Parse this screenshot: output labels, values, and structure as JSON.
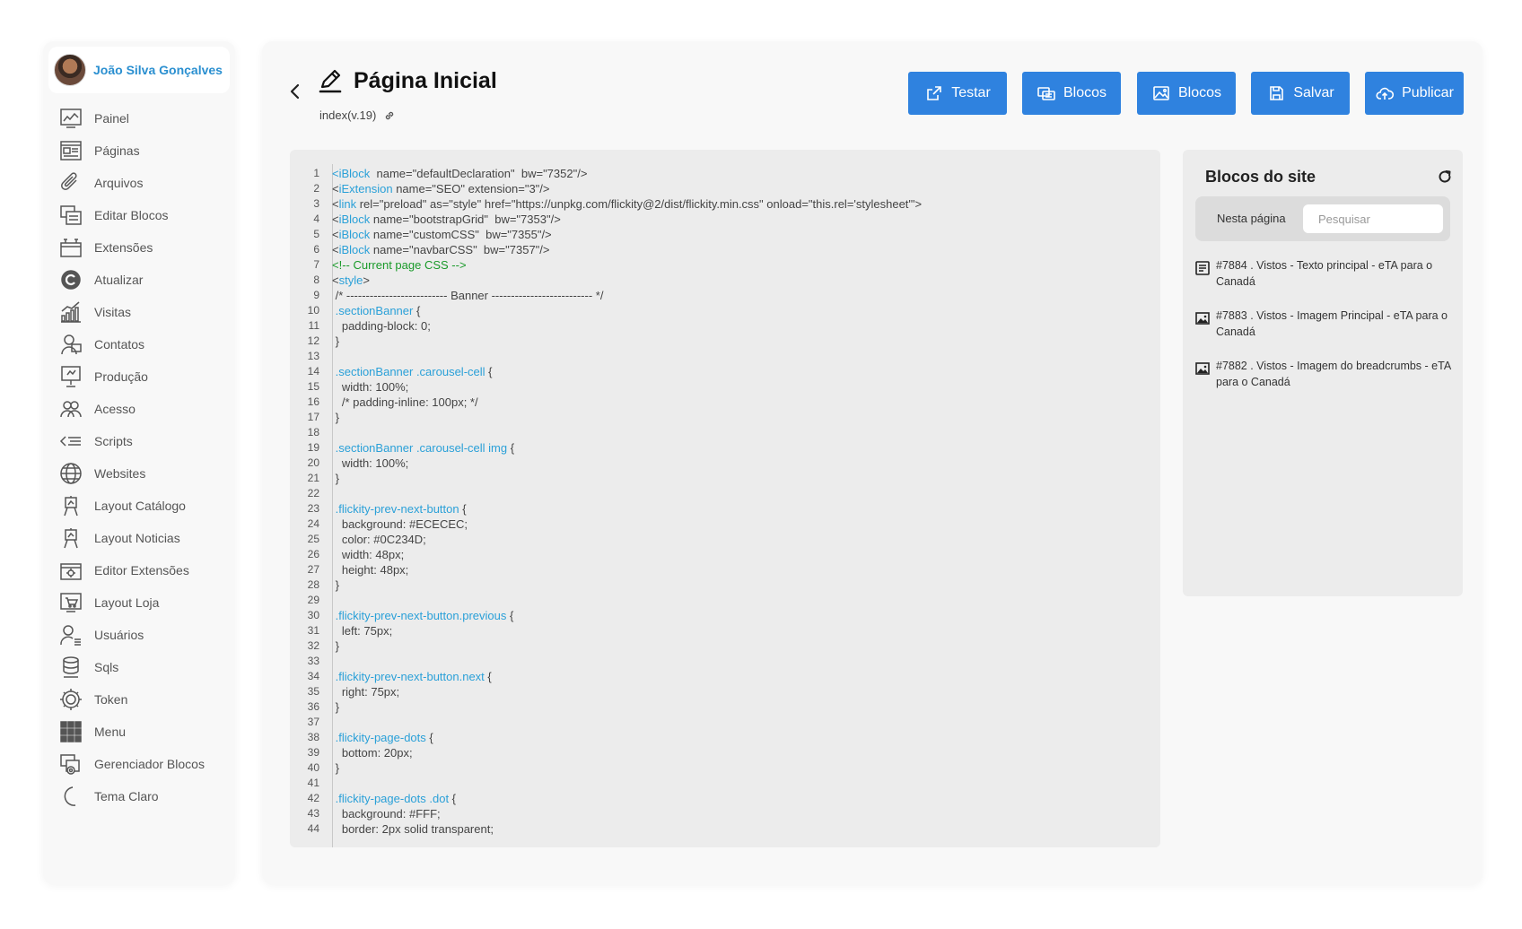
{
  "user": {
    "name": "João Silva Gonçalves"
  },
  "nav": [
    {
      "label": "Painel",
      "icon": "dashboard-icon"
    },
    {
      "label": "Páginas",
      "icon": "pages-icon"
    },
    {
      "label": "Arquivos",
      "icon": "paperclip-icon"
    },
    {
      "label": "Editar Blocos",
      "icon": "blocks-icon"
    },
    {
      "label": "Extensões",
      "icon": "extensions-icon"
    },
    {
      "label": "Atualizar",
      "icon": "update-icon"
    },
    {
      "label": "Visitas",
      "icon": "chart-icon"
    },
    {
      "label": "Contatos",
      "icon": "contacts-icon"
    },
    {
      "label": "Produção",
      "icon": "production-icon"
    },
    {
      "label": "Acesso",
      "icon": "users-group-icon"
    },
    {
      "label": "Scripts",
      "icon": "code-icon"
    },
    {
      "label": "Websites",
      "icon": "globe-icon"
    },
    {
      "label": "Layout Catálogo",
      "icon": "easel-icon"
    },
    {
      "label": "Layout Noticias",
      "icon": "easel-icon"
    },
    {
      "label": "Editor Extensões",
      "icon": "extension-editor-icon"
    },
    {
      "label": "Layout Loja",
      "icon": "store-icon"
    },
    {
      "label": "Usuários",
      "icon": "user-list-icon"
    },
    {
      "label": "Sqls",
      "icon": "database-icon"
    },
    {
      "label": "Token",
      "icon": "token-icon"
    },
    {
      "label": "Menu",
      "icon": "grid-icon"
    },
    {
      "label": "Gerenciador Blocos",
      "icon": "blocks-manager-icon"
    },
    {
      "label": "Tema Claro",
      "icon": "moon-icon"
    }
  ],
  "header": {
    "title": "Página Inicial",
    "subtitle": "index(v.19)",
    "buttons": {
      "testar": "Testar",
      "blocos1": "Blocos",
      "blocos2": "Blocos",
      "salvar": "Salvar",
      "publicar": "Publicar"
    }
  },
  "code_lines": [
    [
      [
        "t-tag",
        "<"
      ],
      [
        "t-sel",
        "iBlock"
      ],
      [
        "",
        "  name=\"defaultDeclaration\"  bw=\"7352\"/>"
      ]
    ],
    [
      [
        "",
        "<"
      ],
      [
        "t-sel",
        "iExtension"
      ],
      [
        "",
        " name=\"SEO\" extension=\"3\"/>"
      ]
    ],
    [
      [
        "",
        "<"
      ],
      [
        "t-sel",
        "link"
      ],
      [
        "",
        " rel=\"preload\" as=\"style\" href=\"https://unpkg.com/flickity@2/dist/flickity.min.css\" onload=\"this.rel='stylesheet'\">"
      ]
    ],
    [
      [
        "",
        "<"
      ],
      [
        "t-sel",
        "iBlock"
      ],
      [
        "",
        " name=\"bootstrapGrid\"  bw=\"7353\"/>"
      ]
    ],
    [
      [
        "",
        "<"
      ],
      [
        "t-sel",
        "iBlock"
      ],
      [
        "",
        " name=\"customCSS\"  bw=\"7355\"/>"
      ]
    ],
    [
      [
        "",
        "<"
      ],
      [
        "t-sel",
        "iBlock"
      ],
      [
        "",
        " name=\"navbarCSS\"  bw=\"7357\"/>"
      ]
    ],
    [
      [
        "t-cmt",
        "<!-- Current page CSS -->"
      ]
    ],
    [
      [
        "",
        "<"
      ],
      [
        "t-sel",
        "style"
      ],
      [
        "",
        ">"
      ]
    ],
    [
      [
        "",
        " /* -------------------------- Banner -------------------------- */"
      ]
    ],
    [
      [
        "t-sel",
        " .sectionBanner"
      ],
      [
        "",
        " {"
      ]
    ],
    [
      [
        "",
        "   padding-block: 0;"
      ]
    ],
    [
      [
        "",
        " }"
      ]
    ],
    [
      [
        "",
        ""
      ]
    ],
    [
      [
        "t-sel",
        " .sectionBanner .carousel-cell"
      ],
      [
        "",
        " {"
      ]
    ],
    [
      [
        "",
        "   width: 100%;"
      ]
    ],
    [
      [
        "",
        "   /* padding-inline: 100px; */"
      ]
    ],
    [
      [
        "",
        " }"
      ]
    ],
    [
      [
        "",
        ""
      ]
    ],
    [
      [
        "t-sel",
        " .sectionBanner .carousel-cell img"
      ],
      [
        "",
        " {"
      ]
    ],
    [
      [
        "",
        "   width: 100%;"
      ]
    ],
    [
      [
        "",
        " }"
      ]
    ],
    [
      [
        "",
        ""
      ]
    ],
    [
      [
        "t-sel",
        " .flickity-prev-next-button"
      ],
      [
        "",
        " {"
      ]
    ],
    [
      [
        "",
        "   background: #ECECEC;"
      ]
    ],
    [
      [
        "",
        "   color: #0C234D;"
      ]
    ],
    [
      [
        "",
        "   width: 48px;"
      ]
    ],
    [
      [
        "",
        "   height: 48px;"
      ]
    ],
    [
      [
        "",
        " }"
      ]
    ],
    [
      [
        "",
        ""
      ]
    ],
    [
      [
        "t-sel",
        " .flickity-prev-next-button.previous"
      ],
      [
        "",
        " {"
      ]
    ],
    [
      [
        "",
        "   left: 75px;"
      ]
    ],
    [
      [
        "",
        " }"
      ]
    ],
    [
      [
        "",
        ""
      ]
    ],
    [
      [
        "t-sel",
        " .flickity-prev-next-button.next"
      ],
      [
        "",
        " {"
      ]
    ],
    [
      [
        "",
        "   right: 75px;"
      ]
    ],
    [
      [
        "",
        " }"
      ]
    ],
    [
      [
        "",
        ""
      ]
    ],
    [
      [
        "t-sel",
        " .flickity-page-dots"
      ],
      [
        "",
        " {"
      ]
    ],
    [
      [
        "",
        "   bottom: 20px;"
      ]
    ],
    [
      [
        "",
        " }"
      ]
    ],
    [
      [
        "",
        ""
      ]
    ],
    [
      [
        "t-sel",
        " .flickity-page-dots .dot"
      ],
      [
        "",
        " {"
      ]
    ],
    [
      [
        "",
        "   background: #FFF;"
      ]
    ],
    [
      [
        "",
        "   border: 2px solid transparent;"
      ]
    ]
  ],
  "blocks_panel": {
    "title": "Blocos do site",
    "tab": "Nesta página",
    "search_placeholder": "Pesquisar",
    "items": [
      {
        "text": "#7884 . Vistos - Texto principal - eTA para o Canadá",
        "icon": "text-doc-icon"
      },
      {
        "text": "#7883 . Vistos - Imagem Principal - eTA para o Canadá",
        "icon": "image-icon"
      },
      {
        "text": "#7882 . Vistos - Imagem do breadcrumbs - eTA para o Canadá",
        "icon": "image-icon"
      }
    ]
  },
  "colors": {
    "accent": "#2f82df",
    "user_name": "#2a8fd0",
    "code_selector": "#2aa0d8",
    "code_comment": "#1a9a2a"
  }
}
